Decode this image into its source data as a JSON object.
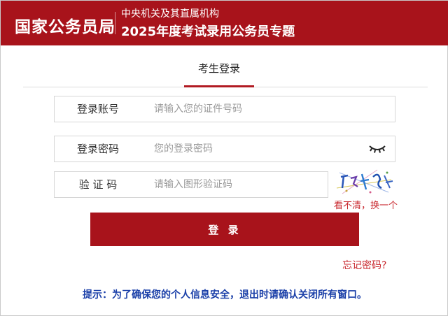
{
  "header": {
    "brand": "国家公务员局",
    "org": "中央机关及其直属机构",
    "special_title": "2025年度考试录用公务员专题"
  },
  "tab": {
    "label": "考生登录"
  },
  "form": {
    "account": {
      "label": "登录账号",
      "placeholder": "请输入您的证件号码",
      "value": ""
    },
    "password": {
      "label": "登录密码",
      "placeholder": "您的登录密码",
      "value": ""
    },
    "captcha": {
      "label": "验 证 码",
      "placeholder": "请输入图形验证码",
      "value": ""
    },
    "captcha_refresh": "看不清，换一个",
    "login_button": "登 录",
    "forgot": "忘记密码?"
  },
  "tip": "提示：为了确保您的个人信息安全，退出时请确认关闭所有窗口。",
  "colors": {
    "brand_red": "#a8131b",
    "link_red": "#c8262c",
    "tip_blue": "#1a3fa8"
  },
  "icons": {
    "password_toggle": "eye-closed-icon",
    "captcha_image": "captcha-image"
  }
}
